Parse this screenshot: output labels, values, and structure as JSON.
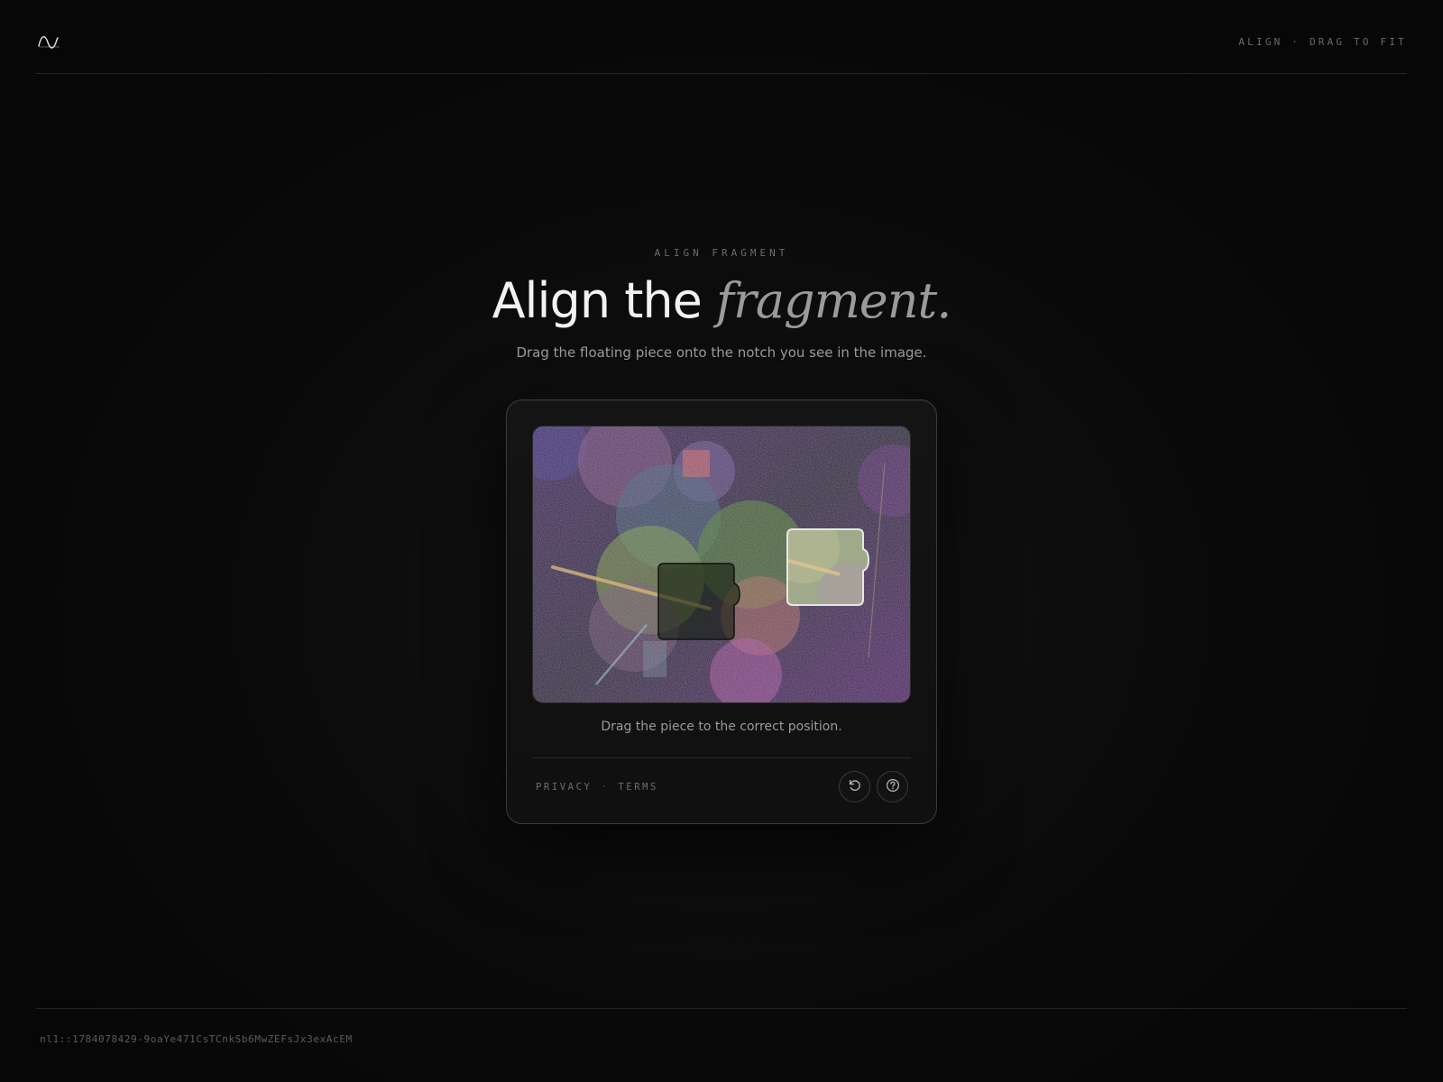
{
  "header": {
    "logo_icon": "wave-logo-icon",
    "tag": "ALIGN · DRAG TO FIT"
  },
  "hero": {
    "eyebrow": "ALIGN FRAGMENT",
    "title_plain": "Align the ",
    "title_accent": "fragment.",
    "subtitle": "Drag the floating piece onto the notch you see in the image."
  },
  "card": {
    "instruction": "Drag the piece to the correct position.",
    "privacy_label": "PRIVACY",
    "separator": "·",
    "terms_label": "TERMS",
    "refresh_icon": "refresh-icon",
    "help_icon": "help-icon"
  },
  "footer": {
    "token": "nl1::1784078429-9oaYe471CsTCnkSb6MwZEFsJx3exAcEM"
  },
  "colors": {
    "background": "#070707",
    "card_border": "#3b3b3b",
    "accent_text": "#9a9a9a",
    "piece_outline": "#e6e6e6"
  }
}
